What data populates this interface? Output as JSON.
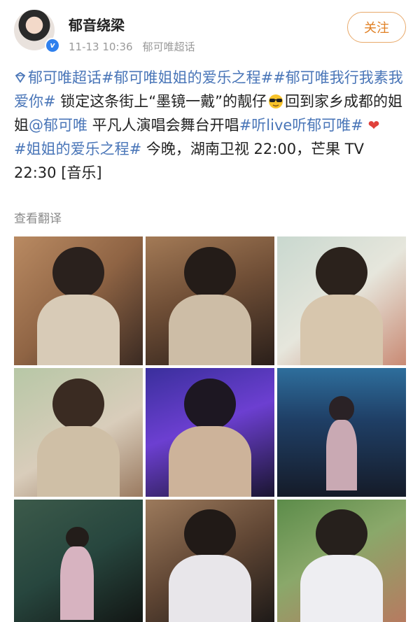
{
  "header": {
    "username": "郁音绕梁",
    "timestamp": "11-13 10:36",
    "source": "郁可唯超话",
    "follow_label": "关注",
    "verified_mark": "v"
  },
  "post": {
    "line1_tags": [
      "郁可唯超话",
      "#郁可唯姐姐的爱乐之程##郁可唯我行我素我爱你#"
    ],
    "seg_topic": "郁可唯超话",
    "seg_tag1": "#郁可唯姐姐的爱乐之程##郁可唯我行我素我爱你#",
    "seg_text1": " 锁定这条街上“墨镜一戴”的靓仔",
    "seg_text2": "回到家乡成都的姐姐",
    "seg_mention": "@郁可唯",
    "seg_text3": " 平凡人演唱会舞台开唱",
    "seg_tag2": "#听live听郁可唯#",
    "seg_tag3": "#姐姐的爱乐之程#",
    "seg_text4": " 今晚，湖南卫视 22:00，芒果 TV 22:30 [音乐]",
    "translate_label": "查看翻译"
  },
  "photos": [
    {
      "name": "photo-1"
    },
    {
      "name": "photo-2"
    },
    {
      "name": "photo-3"
    },
    {
      "name": "photo-4"
    },
    {
      "name": "photo-5"
    },
    {
      "name": "photo-6"
    },
    {
      "name": "photo-7"
    },
    {
      "name": "photo-8"
    },
    {
      "name": "photo-9"
    }
  ],
  "colors": {
    "link": "#4a76b8",
    "follow": "#e07f22",
    "meta": "#9a9a9a",
    "heart": "#e0413b"
  }
}
